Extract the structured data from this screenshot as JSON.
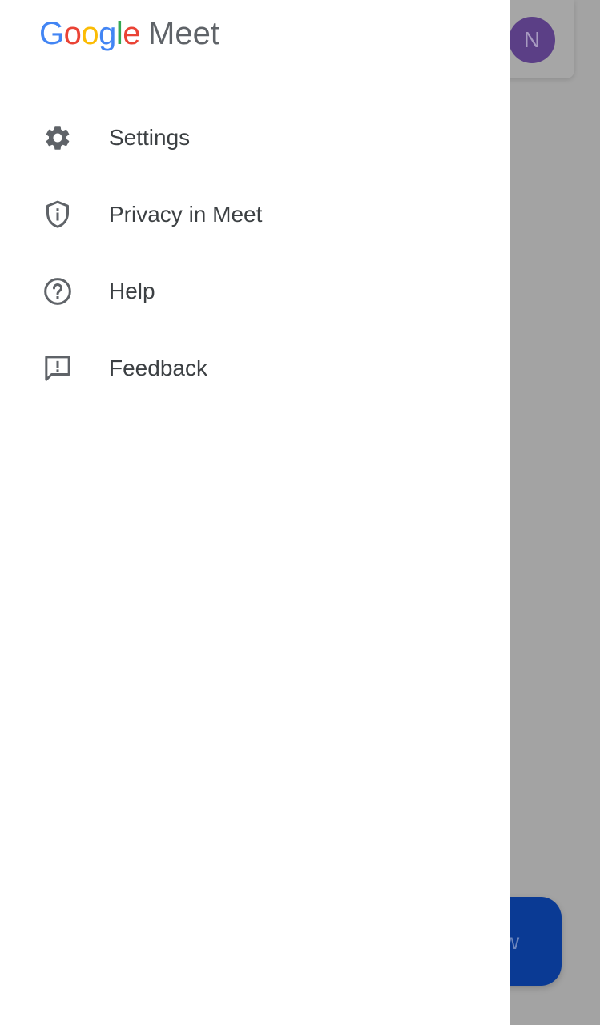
{
  "app": {
    "logo_google_letters": [
      {
        "ch": "G",
        "color": "#4285F4"
      },
      {
        "ch": "o",
        "color": "#EA4335"
      },
      {
        "ch": "o",
        "color": "#FBBC05"
      },
      {
        "ch": "g",
        "color": "#4285F4"
      },
      {
        "ch": "l",
        "color": "#34A853"
      },
      {
        "ch": "e",
        "color": "#EA4335"
      }
    ],
    "logo_product": "Meet"
  },
  "account": {
    "avatar_initial": "N",
    "avatar_color": "#5b3f86"
  },
  "drawer": {
    "items": [
      {
        "label": "Settings",
        "icon": "gear-icon"
      },
      {
        "label": "Privacy in Meet",
        "icon": "shield-info-icon"
      },
      {
        "label": "Help",
        "icon": "help-circle-icon"
      },
      {
        "label": "Feedback",
        "icon": "feedback-icon"
      }
    ]
  },
  "background": {
    "fab_label_partial": "w"
  },
  "colors": {
    "scrim": "#a3a3a3",
    "icon": "#5f6368",
    "text": "#3c4043",
    "fab": "#0a3a94"
  }
}
